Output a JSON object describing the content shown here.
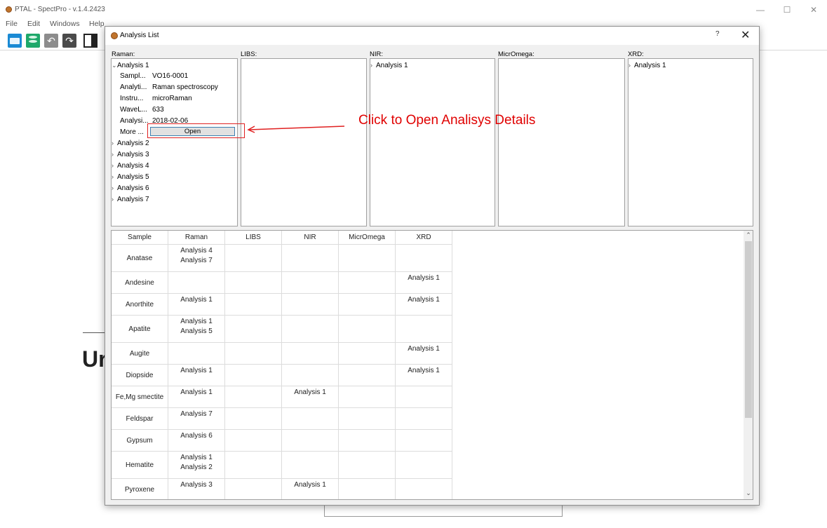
{
  "app": {
    "title": "PTAL - SpectPro -  v.1.4.2423"
  },
  "menu": [
    "File",
    "Edit",
    "Windows",
    "Help"
  ],
  "background": {
    "partial_heading": "Ur"
  },
  "dialog": {
    "title": "Analysis List",
    "help_label": "?",
    "close_label": "✕",
    "panels": [
      {
        "label": "Raman:"
      },
      {
        "label": "LIBS:"
      },
      {
        "label": "NIR:"
      },
      {
        "label": "MicrOmega:"
      },
      {
        "label": "XRD:"
      }
    ],
    "raman_tree": {
      "expanded_item": "Analysis 1",
      "properties": [
        {
          "key": "Sampl...",
          "value": "VO16-0001"
        },
        {
          "key": "Analyti...",
          "value": "Raman spectroscopy"
        },
        {
          "key": "Instru...",
          "value": "microRaman"
        },
        {
          "key": "WaveL...",
          "value": "633"
        },
        {
          "key": "Analysi...",
          "value": "2018-02-06"
        },
        {
          "key": "More ...",
          "value": ""
        }
      ],
      "open_button": "Open",
      "collapsed_items": [
        "Analysis 2",
        "Analysis 3",
        "Analysis 4",
        "Analysis 5",
        "Analysis 6",
        "Analysis 7"
      ]
    },
    "nir_tree": {
      "items": [
        "Analysis 1"
      ]
    },
    "xrd_tree": {
      "items": [
        "Analysis 1"
      ]
    },
    "annotation": "Click to Open Analisys Details",
    "table": {
      "columns": [
        "Sample",
        "Raman",
        "LIBS",
        "NIR",
        "MicrOmega",
        "XRD"
      ],
      "rows": [
        {
          "sample": "Anatase",
          "raman": [
            "Analysis 4",
            "Analysis 7"
          ],
          "libs": [],
          "nir": [],
          "micromega": [],
          "xrd": []
        },
        {
          "sample": "Andesine",
          "raman": [],
          "libs": [],
          "nir": [],
          "micromega": [],
          "xrd": [
            "Analysis 1"
          ]
        },
        {
          "sample": "Anorthite",
          "raman": [
            "Analysis 1"
          ],
          "libs": [],
          "nir": [],
          "micromega": [],
          "xrd": [
            "Analysis 1"
          ]
        },
        {
          "sample": "Apatite",
          "raman": [
            "Analysis 1",
            "Analysis 5"
          ],
          "libs": [],
          "nir": [],
          "micromega": [],
          "xrd": []
        },
        {
          "sample": "Augite",
          "raman": [],
          "libs": [],
          "nir": [],
          "micromega": [],
          "xrd": [
            "Analysis 1"
          ]
        },
        {
          "sample": "Diopside",
          "raman": [
            "Analysis 1"
          ],
          "libs": [],
          "nir": [],
          "micromega": [],
          "xrd": [
            "Analysis 1"
          ]
        },
        {
          "sample": "Fe,Mg smectite",
          "raman": [
            "Analysis 1"
          ],
          "libs": [],
          "nir": [
            "Analysis 1"
          ],
          "micromega": [],
          "xrd": []
        },
        {
          "sample": "Feldspar",
          "raman": [
            "Analysis 7"
          ],
          "libs": [],
          "nir": [],
          "micromega": [],
          "xrd": []
        },
        {
          "sample": "Gypsum",
          "raman": [
            "Analysis 6"
          ],
          "libs": [],
          "nir": [],
          "micromega": [],
          "xrd": []
        },
        {
          "sample": "Hematite",
          "raman": [
            "Analysis 1",
            "Analysis 2"
          ],
          "libs": [],
          "nir": [],
          "micromega": [],
          "xrd": []
        },
        {
          "sample": "Pyroxene",
          "raman": [
            "Analysis 3"
          ],
          "libs": [],
          "nir": [
            "Analysis 1"
          ],
          "micromega": [],
          "xrd": []
        }
      ]
    }
  }
}
